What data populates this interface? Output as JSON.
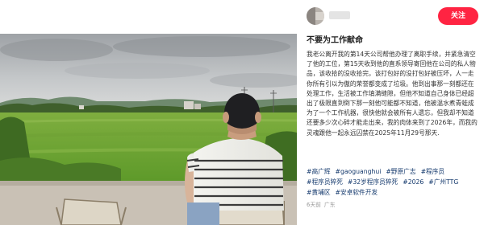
{
  "author": {
    "name": "",
    "follow_label": "关注"
  },
  "post": {
    "title": "不要为工作献命",
    "body": "我老公离开我的第14天公司帮他办理了离职手续，并紧急清空了他的工位，第15天收到他的直系领导寄回他在公司的私人物品，该收拾的没收拾完，该打包好的没打包好被压坏，人一走你所有引以为傲的荣誉都变成了垃圾。他到出事那一刻都还在处理工作，生活被工作填满缝隙，但他不知道自己身体已经超出了极限直到倒下那一刻他可能都不知道，他被温水煮青蛙成为了一个工作机器，很快他就会被所有人遗忘，但我却不知道还要多少次心碎才能走出来，我的肉体来到了2026年，而我的灵魂跟他一起永远囚禁在2025年11月29号那天.",
    "tags": [
      "#高广辉",
      "#gaoguanghui",
      "#野原广志",
      "#程序员",
      "#程序员猝死",
      "#32岁程序员猝死",
      "#2026",
      "#广州TTG",
      "#黄埔区",
      "#安卓软件开发"
    ],
    "meta": {
      "time": "6天前",
      "location": "广东"
    }
  },
  "photo": {
    "icons": [
      "person-back",
      "camping-chair",
      "rice-field",
      "cloudy-sky"
    ]
  }
}
